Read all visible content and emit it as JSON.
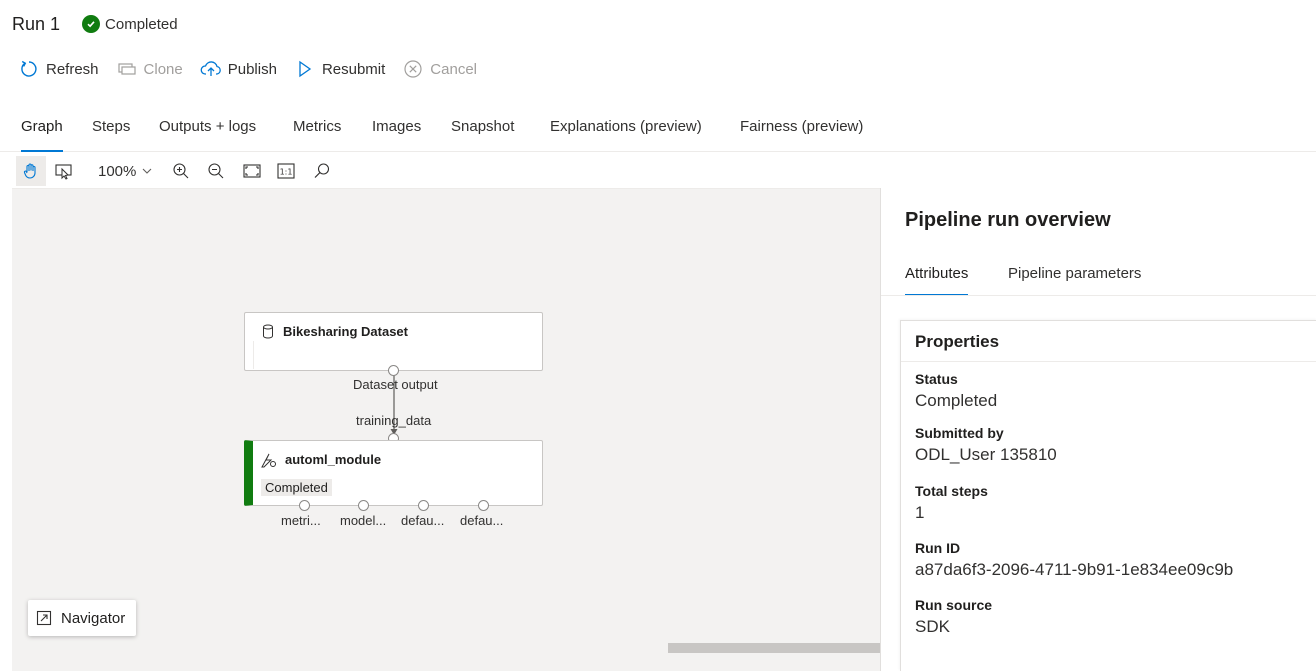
{
  "header": {
    "title": "Run 1",
    "status": "Completed",
    "status_color": "#107c10"
  },
  "toolbar": {
    "refresh": "Refresh",
    "clone": "Clone",
    "publish": "Publish",
    "resubmit": "Resubmit",
    "cancel": "Cancel"
  },
  "tabs": [
    {
      "label": "Graph",
      "active": true
    },
    {
      "label": "Steps"
    },
    {
      "label": "Outputs + logs"
    },
    {
      "label": "Metrics"
    },
    {
      "label": "Images"
    },
    {
      "label": "Snapshot"
    },
    {
      "label": "Explanations (preview)"
    },
    {
      "label": "Fairness (preview)"
    }
  ],
  "graph_toolbar": {
    "zoom": "100%",
    "tools": [
      "pan-hand-icon",
      "select-icon",
      "zoom-in-icon",
      "zoom-out-icon",
      "fit-to-screen-icon",
      "actual-size-icon",
      "search-icon"
    ]
  },
  "graph": {
    "dataset_node": {
      "title": "Bikesharing Dataset",
      "icon": "dataset-cylinder-icon"
    },
    "dataset_output_label": "Dataset output",
    "input_label": "training_data",
    "module_node": {
      "title": "automl_module",
      "status": "Completed",
      "icon": "automl-icon",
      "status_color": "#107c10"
    },
    "outputs": [
      "metri...",
      "model...",
      "defau...",
      "defau..."
    ]
  },
  "navigator": {
    "label": "Navigator"
  },
  "panel": {
    "title": "Pipeline run overview",
    "tabs": [
      {
        "label": "Attributes",
        "active": true
      },
      {
        "label": "Pipeline parameters"
      }
    ],
    "properties": {
      "title": "Properties",
      "items": [
        {
          "label": "Status",
          "value": "Completed"
        },
        {
          "label": "Submitted by",
          "value": "ODL_User 135810"
        },
        {
          "label": "Total steps",
          "value": "1"
        },
        {
          "label": "Run ID",
          "value": "a87da6f3-2096-4711-9b91-1e834ee09c9b"
        },
        {
          "label": "Run source",
          "value": "SDK"
        }
      ]
    }
  }
}
